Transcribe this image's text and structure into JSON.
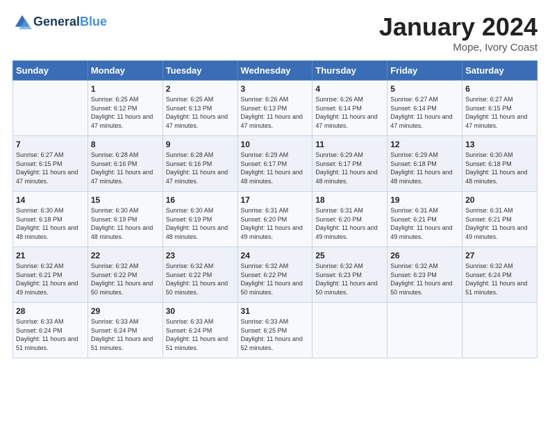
{
  "header": {
    "logo_general": "General",
    "logo_blue": "Blue",
    "month": "January 2024",
    "location": "Mope, Ivory Coast"
  },
  "days_of_week": [
    "Sunday",
    "Monday",
    "Tuesday",
    "Wednesday",
    "Thursday",
    "Friday",
    "Saturday"
  ],
  "weeks": [
    [
      {
        "day": "",
        "sunrise": "",
        "sunset": "",
        "daylight": ""
      },
      {
        "day": "1",
        "sunrise": "Sunrise: 6:25 AM",
        "sunset": "Sunset: 6:12 PM",
        "daylight": "Daylight: 11 hours and 47 minutes."
      },
      {
        "day": "2",
        "sunrise": "Sunrise: 6:25 AM",
        "sunset": "Sunset: 6:13 PM",
        "daylight": "Daylight: 11 hours and 47 minutes."
      },
      {
        "day": "3",
        "sunrise": "Sunrise: 6:26 AM",
        "sunset": "Sunset: 6:13 PM",
        "daylight": "Daylight: 11 hours and 47 minutes."
      },
      {
        "day": "4",
        "sunrise": "Sunrise: 6:26 AM",
        "sunset": "Sunset: 6:14 PM",
        "daylight": "Daylight: 11 hours and 47 minutes."
      },
      {
        "day": "5",
        "sunrise": "Sunrise: 6:27 AM",
        "sunset": "Sunset: 6:14 PM",
        "daylight": "Daylight: 11 hours and 47 minutes."
      },
      {
        "day": "6",
        "sunrise": "Sunrise: 6:27 AM",
        "sunset": "Sunset: 6:15 PM",
        "daylight": "Daylight: 11 hours and 47 minutes."
      }
    ],
    [
      {
        "day": "7",
        "sunrise": "Sunrise: 6:27 AM",
        "sunset": "Sunset: 6:15 PM",
        "daylight": "Daylight: 11 hours and 47 minutes."
      },
      {
        "day": "8",
        "sunrise": "Sunrise: 6:28 AM",
        "sunset": "Sunset: 6:16 PM",
        "daylight": "Daylight: 11 hours and 47 minutes."
      },
      {
        "day": "9",
        "sunrise": "Sunrise: 6:28 AM",
        "sunset": "Sunset: 6:16 PM",
        "daylight": "Daylight: 11 hours and 47 minutes."
      },
      {
        "day": "10",
        "sunrise": "Sunrise: 6:29 AM",
        "sunset": "Sunset: 6:17 PM",
        "daylight": "Daylight: 11 hours and 48 minutes."
      },
      {
        "day": "11",
        "sunrise": "Sunrise: 6:29 AM",
        "sunset": "Sunset: 6:17 PM",
        "daylight": "Daylight: 11 hours and 48 minutes."
      },
      {
        "day": "12",
        "sunrise": "Sunrise: 6:29 AM",
        "sunset": "Sunset: 6:18 PM",
        "daylight": "Daylight: 11 hours and 48 minutes."
      },
      {
        "day": "13",
        "sunrise": "Sunrise: 6:30 AM",
        "sunset": "Sunset: 6:18 PM",
        "daylight": "Daylight: 11 hours and 48 minutes."
      }
    ],
    [
      {
        "day": "14",
        "sunrise": "Sunrise: 6:30 AM",
        "sunset": "Sunset: 6:18 PM",
        "daylight": "Daylight: 11 hours and 48 minutes."
      },
      {
        "day": "15",
        "sunrise": "Sunrise: 6:30 AM",
        "sunset": "Sunset: 6:19 PM",
        "daylight": "Daylight: 11 hours and 48 minutes."
      },
      {
        "day": "16",
        "sunrise": "Sunrise: 6:30 AM",
        "sunset": "Sunset: 6:19 PM",
        "daylight": "Daylight: 11 hours and 48 minutes."
      },
      {
        "day": "17",
        "sunrise": "Sunrise: 6:31 AM",
        "sunset": "Sunset: 6:20 PM",
        "daylight": "Daylight: 11 hours and 49 minutes."
      },
      {
        "day": "18",
        "sunrise": "Sunrise: 6:31 AM",
        "sunset": "Sunset: 6:20 PM",
        "daylight": "Daylight: 11 hours and 49 minutes."
      },
      {
        "day": "19",
        "sunrise": "Sunrise: 6:31 AM",
        "sunset": "Sunset: 6:21 PM",
        "daylight": "Daylight: 11 hours and 49 minutes."
      },
      {
        "day": "20",
        "sunrise": "Sunrise: 6:31 AM",
        "sunset": "Sunset: 6:21 PM",
        "daylight": "Daylight: 11 hours and 49 minutes."
      }
    ],
    [
      {
        "day": "21",
        "sunrise": "Sunrise: 6:32 AM",
        "sunset": "Sunset: 6:21 PM",
        "daylight": "Daylight: 11 hours and 49 minutes."
      },
      {
        "day": "22",
        "sunrise": "Sunrise: 6:32 AM",
        "sunset": "Sunset: 6:22 PM",
        "daylight": "Daylight: 11 hours and 50 minutes."
      },
      {
        "day": "23",
        "sunrise": "Sunrise: 6:32 AM",
        "sunset": "Sunset: 6:22 PM",
        "daylight": "Daylight: 11 hours and 50 minutes."
      },
      {
        "day": "24",
        "sunrise": "Sunrise: 6:32 AM",
        "sunset": "Sunset: 6:22 PM",
        "daylight": "Daylight: 11 hours and 50 minutes."
      },
      {
        "day": "25",
        "sunrise": "Sunrise: 6:32 AM",
        "sunset": "Sunset: 6:23 PM",
        "daylight": "Daylight: 11 hours and 50 minutes."
      },
      {
        "day": "26",
        "sunrise": "Sunrise: 6:32 AM",
        "sunset": "Sunset: 6:23 PM",
        "daylight": "Daylight: 11 hours and 50 minutes."
      },
      {
        "day": "27",
        "sunrise": "Sunrise: 6:32 AM",
        "sunset": "Sunset: 6:24 PM",
        "daylight": "Daylight: 11 hours and 51 minutes."
      }
    ],
    [
      {
        "day": "28",
        "sunrise": "Sunrise: 6:33 AM",
        "sunset": "Sunset: 6:24 PM",
        "daylight": "Daylight: 11 hours and 51 minutes."
      },
      {
        "day": "29",
        "sunrise": "Sunrise: 6:33 AM",
        "sunset": "Sunset: 6:24 PM",
        "daylight": "Daylight: 11 hours and 51 minutes."
      },
      {
        "day": "30",
        "sunrise": "Sunrise: 6:33 AM",
        "sunset": "Sunset: 6:24 PM",
        "daylight": "Daylight: 11 hours and 51 minutes."
      },
      {
        "day": "31",
        "sunrise": "Sunrise: 6:33 AM",
        "sunset": "Sunset: 6:25 PM",
        "daylight": "Daylight: 11 hours and 52 minutes."
      },
      {
        "day": "",
        "sunrise": "",
        "sunset": "",
        "daylight": ""
      },
      {
        "day": "",
        "sunrise": "",
        "sunset": "",
        "daylight": ""
      },
      {
        "day": "",
        "sunrise": "",
        "sunset": "",
        "daylight": ""
      }
    ]
  ]
}
